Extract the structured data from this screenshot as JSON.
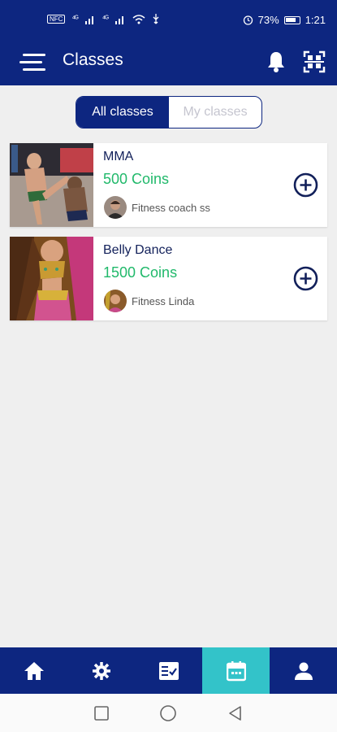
{
  "status_bar": {
    "net_badge": "NFC",
    "signal_1": "⁴ᴳ",
    "signal_2": "⁴ᴳ",
    "battery_percent": "73%",
    "time": "1:21",
    "icons": [
      "signal-icon",
      "signal-icon",
      "wifi-icon",
      "usb-icon",
      "alarm-icon",
      "battery-icon"
    ]
  },
  "header": {
    "title": "Classes",
    "icons": [
      "menu-icon",
      "bell-icon",
      "qr-scan-icon"
    ]
  },
  "tabs": {
    "all": "All classes",
    "mine": "My classes",
    "active": "all"
  },
  "classes": [
    {
      "title": "MMA",
      "price": "500 Coins",
      "coach": "Fitness coach ss",
      "action_icon": "add-circle-icon"
    },
    {
      "title": "Belly Dance",
      "price": "1500 Coins",
      "coach": "Fitness Linda",
      "action_icon": "add-circle-icon"
    }
  ],
  "bottom_nav": {
    "items": [
      "home-icon",
      "settings-icon",
      "checklist-icon",
      "calendar-icon",
      "profile-icon"
    ],
    "active": "calendar-icon"
  },
  "system_nav": {
    "items": [
      "recents-square-icon",
      "home-circle-icon",
      "back-triangle-icon"
    ]
  },
  "colors": {
    "primary": "#0d2680",
    "accent": "#33c3c9",
    "price": "#21b96b",
    "background": "#efefef"
  }
}
